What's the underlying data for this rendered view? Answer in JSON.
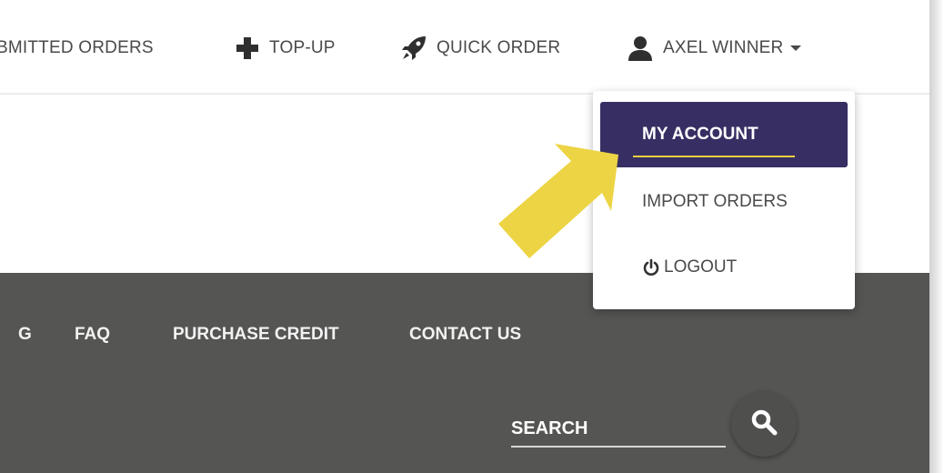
{
  "topnav": {
    "submitted_orders": "BMITTED ORDERS",
    "topup": "TOP-UP",
    "quick_order": "QUICK ORDER",
    "user_name": "AXEL WINNER"
  },
  "dropdown": {
    "items": [
      {
        "label": "MY ACCOUNT",
        "active": true
      },
      {
        "label": "IMPORT ORDERS"
      },
      {
        "label": "LOGOUT"
      }
    ]
  },
  "footer": {
    "links": [
      "G",
      "FAQ",
      "PURCHASE CREDIT",
      "CONTACT US"
    ],
    "search_placeholder": "SEARCH"
  },
  "colors": {
    "menu_active_bg": "#372e63",
    "footer_bg": "#555553",
    "arrow": "#ecd444",
    "active_underline": "#e8cf3f"
  },
  "icons": [
    "plus-icon",
    "rocket-icon",
    "user-icon",
    "caret-down-icon",
    "power-icon",
    "search-icon"
  ]
}
